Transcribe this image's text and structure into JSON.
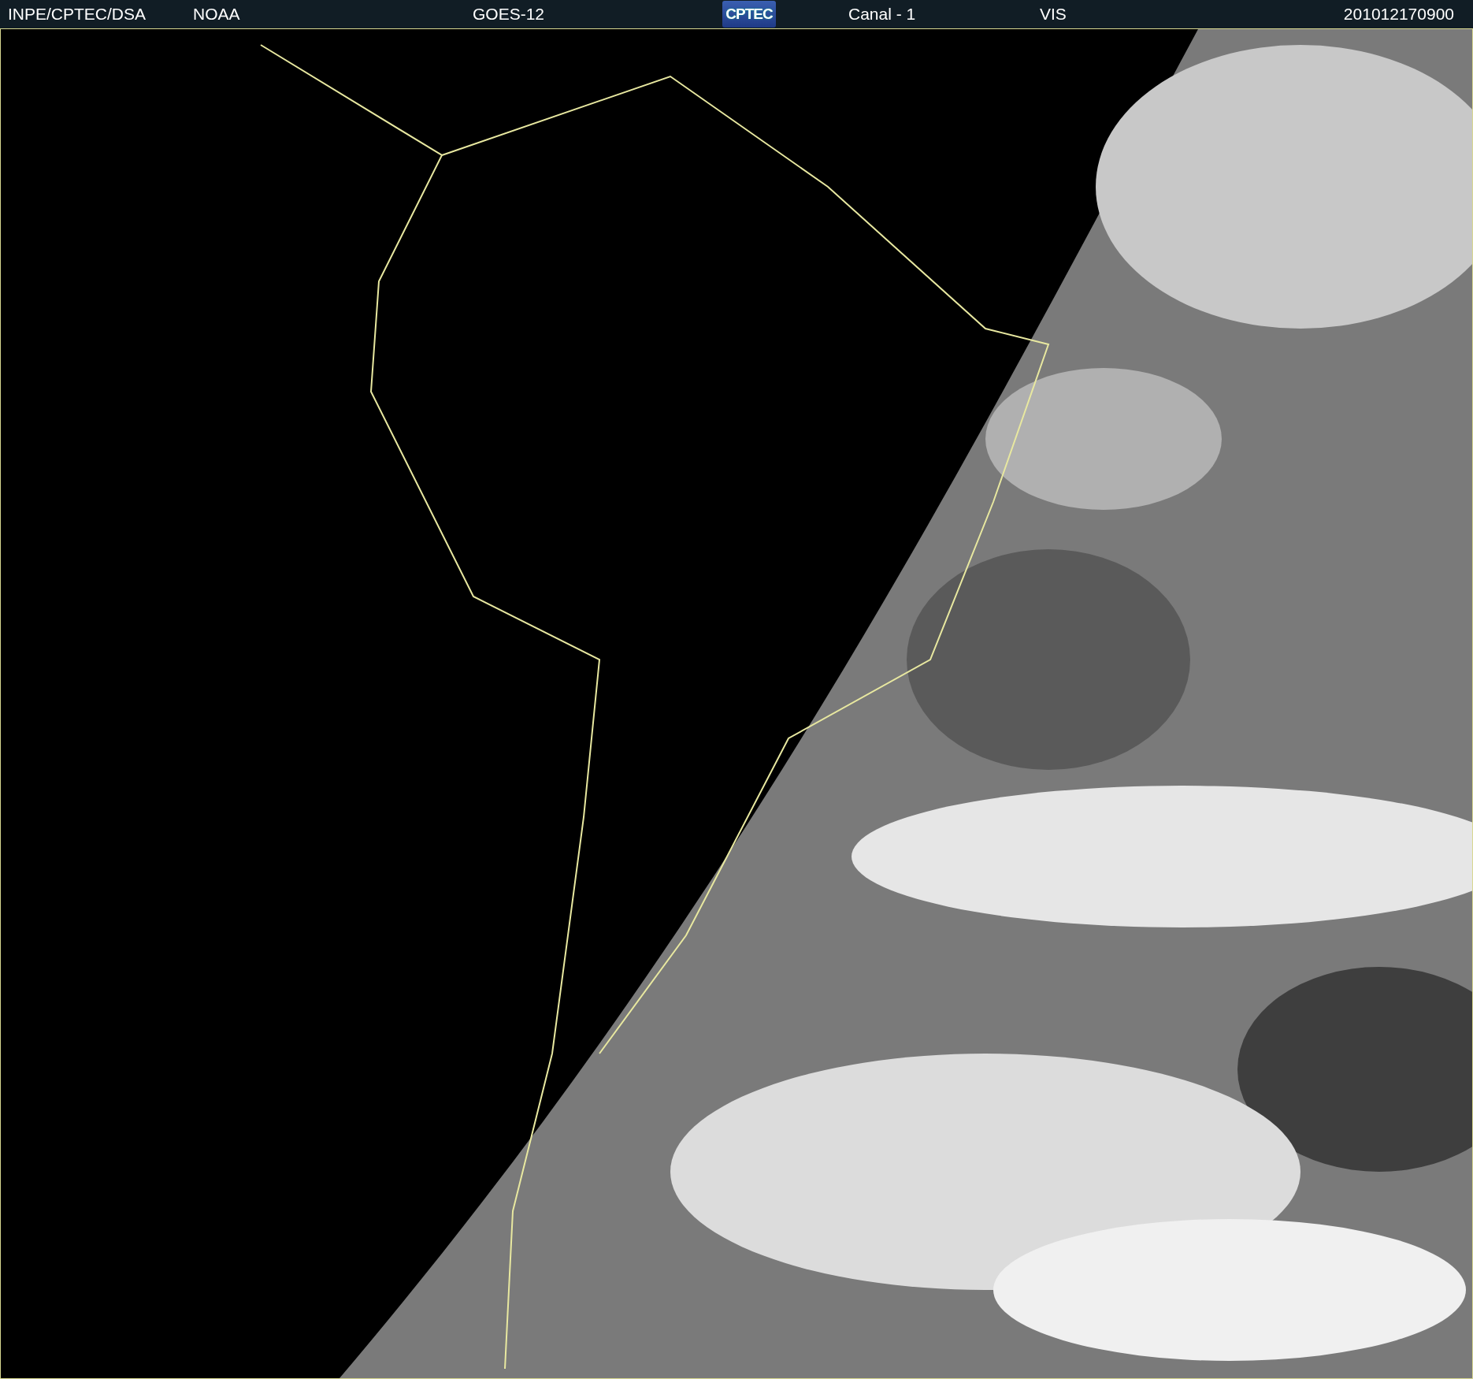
{
  "header": {
    "items": [
      {
        "kind": "text",
        "text": "INPE/CPTEC/DSA"
      },
      {
        "kind": "text",
        "text": "NOAA"
      },
      {
        "kind": "text",
        "text": "GOES-12"
      },
      {
        "kind": "logo",
        "text": "CPTEC"
      },
      {
        "kind": "text",
        "text": "Canal - 1"
      },
      {
        "kind": "text",
        "text": "VIS"
      },
      {
        "kind": "text",
        "text": "201012170900"
      }
    ]
  }
}
